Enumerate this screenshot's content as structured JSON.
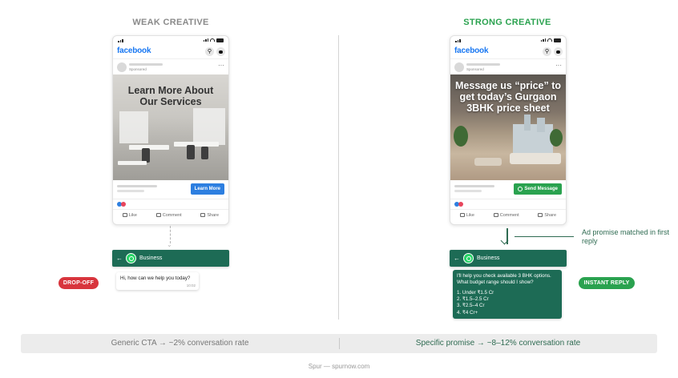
{
  "headings": {
    "weak": "WEAK CREATIVE",
    "strong": "STRONG CREATIVE"
  },
  "phone_common": {
    "brand": "facebook",
    "sponsored": "Sponsored",
    "actions": {
      "like": "Like",
      "comment": "Comment",
      "share": "Share"
    }
  },
  "weak_ad": {
    "headline": "Learn More About Our Services",
    "cta_label": "Learn More"
  },
  "strong_ad": {
    "headline": "Message us “price” to get today’s Gurgaon 3BHK price sheet",
    "cta_label": "Send Message"
  },
  "annotation": "Ad promise matched in first reply",
  "whatsapp": {
    "contact_name": "Business",
    "weak_reply": "Hi, how can we help you today?",
    "weak_reply_time": "10:02",
    "strong_reply_lines": [
      "I'll help you check available 3 BHK options.",
      "What budget range should I show?",
      "",
      "1. Under ₹1.5 Cr",
      "2. ₹1.5–2.5 Cr",
      "3. ₹2.5–4 Cr",
      "4. ₹4 Cr+"
    ]
  },
  "badges": {
    "drop_off": "DROP-OFF",
    "instant_reply": "INSTANT REPLY"
  },
  "footer": {
    "weak_result": "Generic CTA → ~2% conversation rate",
    "strong_result": "Specific promise → ~8–12% conversation rate",
    "credit": "Spur — spurnow.com"
  },
  "colors": {
    "strong_green": "#2aa24f",
    "whatsapp_teal": "#1d6b55",
    "drop_red": "#d8353d",
    "facebook_blue": "#1877f2"
  }
}
